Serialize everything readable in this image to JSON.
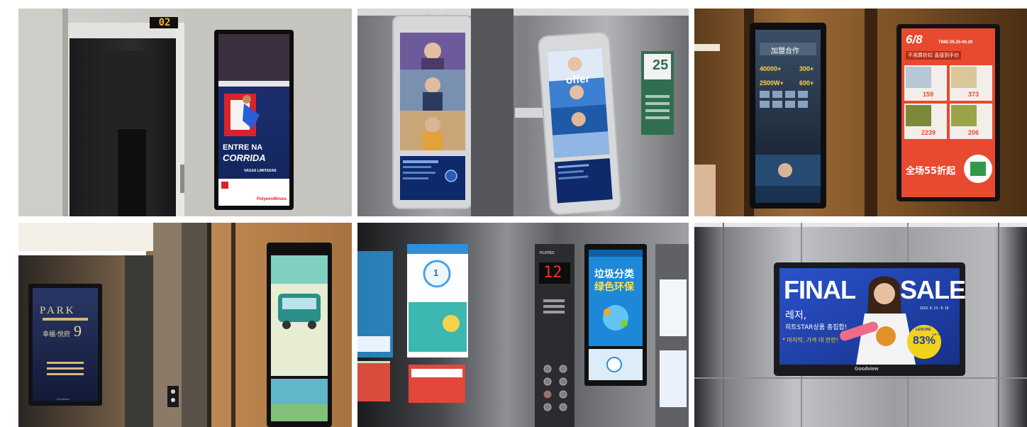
{
  "photos": [
    {
      "floor_indicator": "02",
      "screen_text": [
        "ENTRE NA",
        "CORRIDA",
        "VAGAS LIMITADAS",
        "PolyeonMoves"
      ],
      "colors": {
        "wall": "#c9c7c2",
        "screen": "#1a2a6c",
        "accent": "#d9232a"
      }
    },
    {
      "screen_text": [
        "offer"
      ],
      "sign_number": "25",
      "colors": {
        "wall": "#8e9094",
        "panel_frame": "#d8d9db",
        "sign": "#2f6f4f"
      }
    },
    {
      "screen_text_left": [
        "加盟合作",
        "40000+",
        "300+",
        "2500W+",
        "600+"
      ],
      "screen_text_right": [
        "6/8",
        "不用算折扣 直接到手价",
        "TIME:05.25-06.20",
        "159",
        "373",
        "2239",
        "206",
        "全场55折起"
      ],
      "colors": {
        "wood": "#8a5a2b",
        "promo": "#e84a2f"
      }
    },
    {
      "screen_text": [
        "PARK",
        "幸福·悦府",
        "9",
        "Goodview"
      ],
      "colors": {
        "wood": "#b07a45",
        "screen": "#1c2340"
      }
    },
    {
      "floor_display": "12",
      "brand_label": "FUJITEC",
      "screen_text_left": [
        "1"
      ],
      "screen_text_right": [
        "垃圾分类",
        "绿色环保"
      ],
      "colors": {
        "steel": "#6f7277",
        "screen": "#1e88d8"
      }
    },
    {
      "headline_left": "FINAL",
      "headline_right": "SALE",
      "korean_line1": "레저,",
      "korean_line2": "히트STAR상품 총집합!",
      "korean_line3": "* 마지막, 가격 대 반란!",
      "date_range": "2015. 8. 13 - 8. 18",
      "badge_top": "LEISURE",
      "badge_value": "83%",
      "badge_side": "UP TO",
      "brand": "Goodview",
      "colors": {
        "steel": "#a7a9ad",
        "banner": "#1f3fa6",
        "badge": "#f2d21b"
      }
    }
  ]
}
